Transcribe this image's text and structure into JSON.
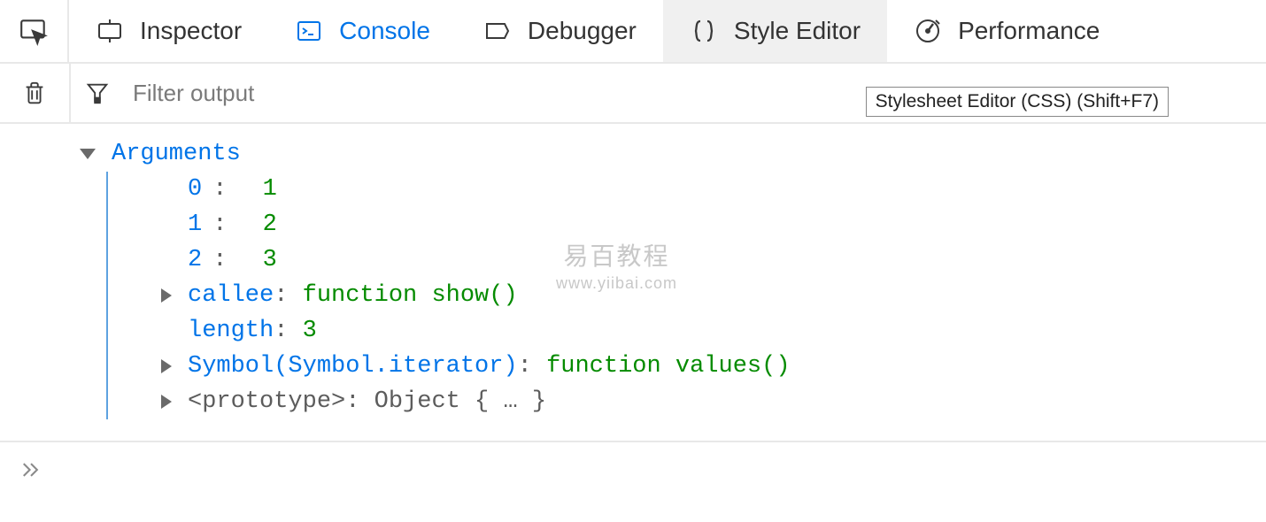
{
  "tabs": {
    "inspector": "Inspector",
    "console": "Console",
    "debugger": "Debugger",
    "style_editor": "Style Editor",
    "performance": "Performance"
  },
  "toolbar": {
    "filter_placeholder": "Filter output",
    "tooltip": "Stylesheet Editor (CSS) (Shift+F7)"
  },
  "console_output": {
    "root_label": "Arguments",
    "items": [
      {
        "key": "0",
        "sep": ":",
        "val": "1"
      },
      {
        "key": "1",
        "sep": ":",
        "val": "2"
      },
      {
        "key": "2",
        "sep": ":",
        "val": "3"
      }
    ],
    "callee_key": "callee",
    "callee_sep": ": ",
    "callee_val": "function show()",
    "length_key": "length",
    "length_sep": ": ",
    "length_val": "3",
    "iterator_key": "Symbol(Symbol.iterator)",
    "iterator_sep": ": ",
    "iterator_val": "function values()",
    "proto_key": "<prototype>",
    "proto_sep": ": ",
    "proto_val": "Object { … }"
  },
  "watermark": {
    "line1": "易百教程",
    "line2": "www.yiibai.com"
  }
}
